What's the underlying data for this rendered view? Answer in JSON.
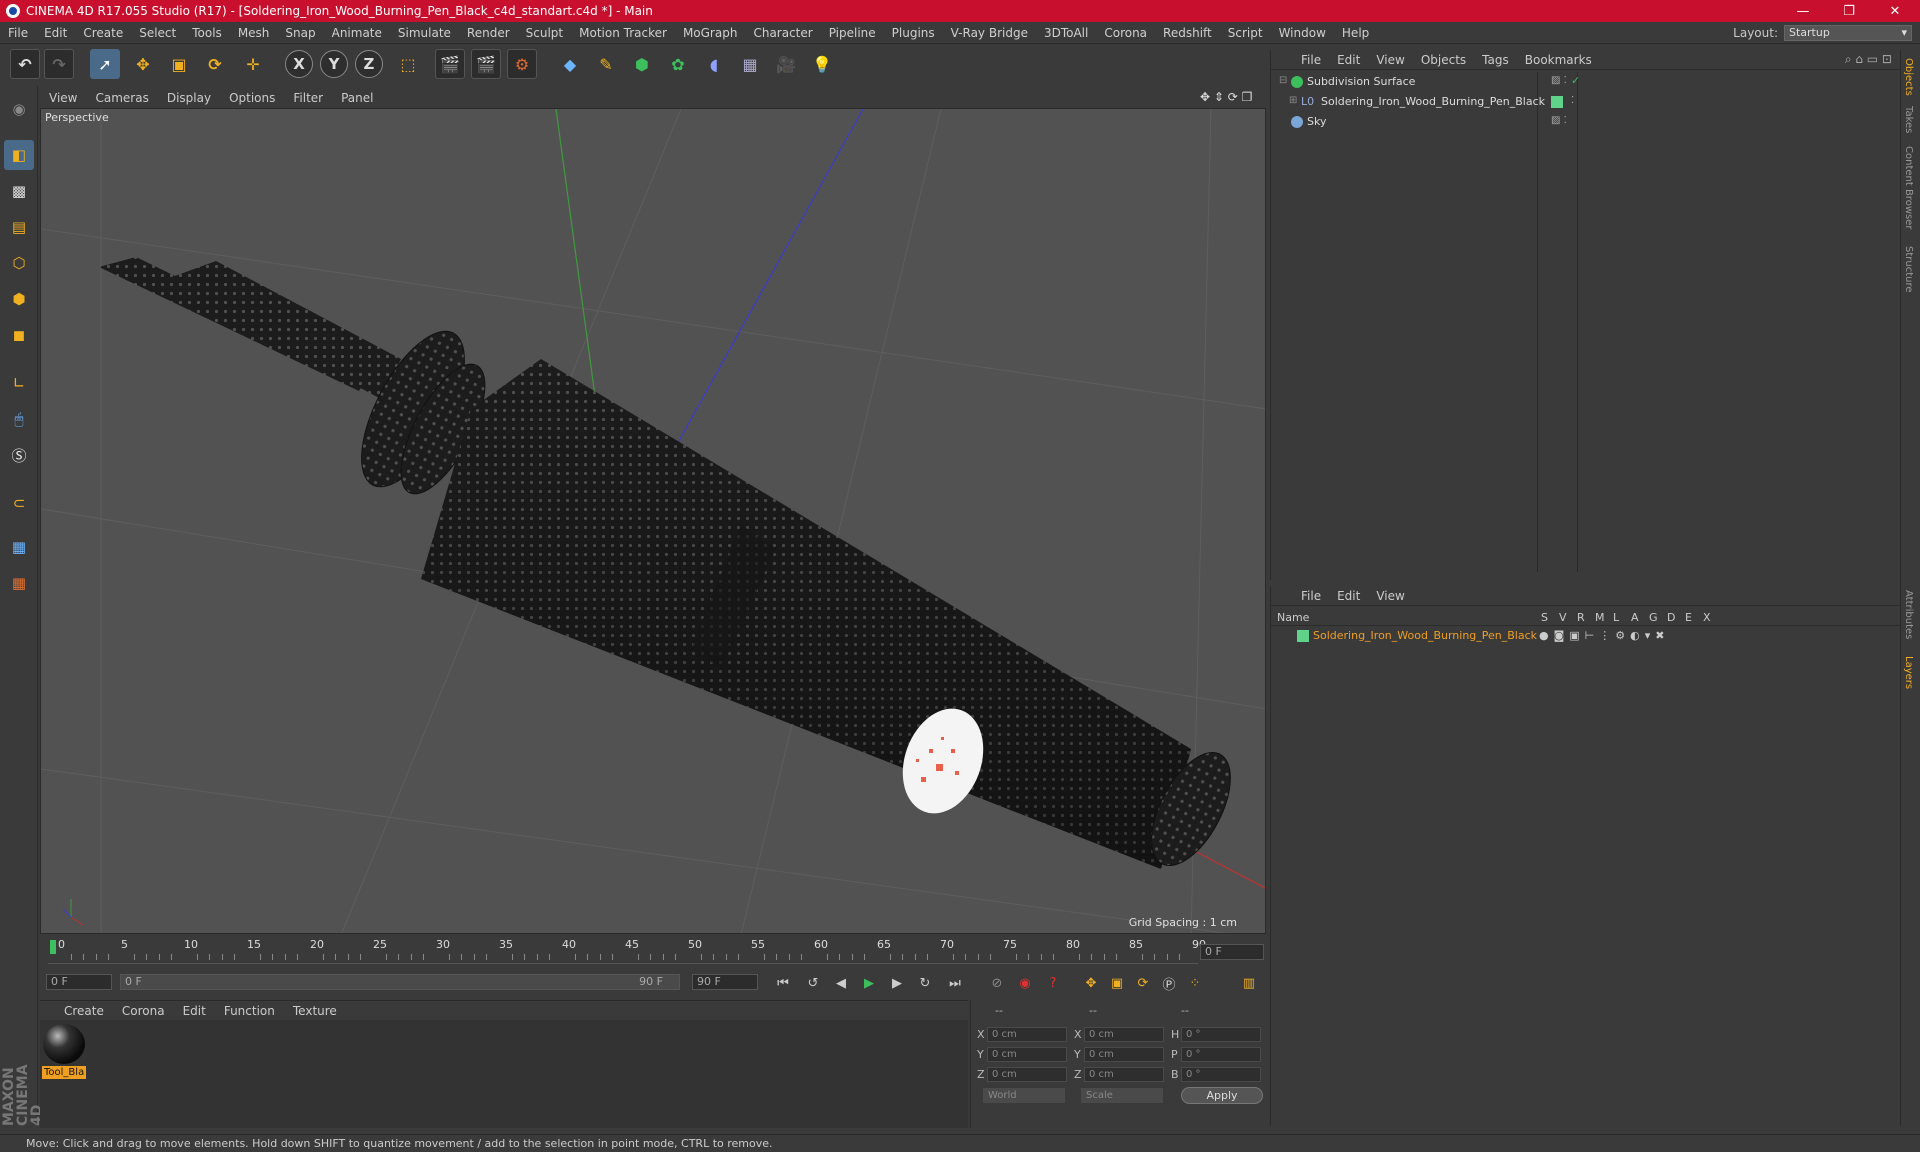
{
  "window": {
    "title": "CINEMA 4D R17.055 Studio (R17) - [Soldering_Iron_Wood_Burning_Pen_Black_c4d_standart.c4d *] - Main",
    "controls": [
      "—",
      "❐",
      "✕"
    ]
  },
  "menu": [
    "File",
    "Edit",
    "Create",
    "Select",
    "Tools",
    "Mesh",
    "Snap",
    "Animate",
    "Simulate",
    "Render",
    "Sculpt",
    "Motion Tracker",
    "MoGraph",
    "Character",
    "Pipeline",
    "Plugins",
    "V-Ray Bridge",
    "3DToAll",
    "Corona",
    "Redshift",
    "Script",
    "Window",
    "Help"
  ],
  "layout": {
    "label": "Layout:",
    "value": "Startup"
  },
  "toolbar": {
    "axis_x": "X",
    "axis_y": "Y",
    "axis_z": "Z"
  },
  "viewport": {
    "menu": [
      "View",
      "Cameras",
      "Display",
      "Options",
      "Filter",
      "Panel"
    ],
    "camera_label": "Perspective",
    "grid_spacing": "Grid Spacing : 1 cm"
  },
  "timeline": {
    "ticks": [
      "0",
      "5",
      "10",
      "15",
      "20",
      "25",
      "30",
      "35",
      "40",
      "45",
      "50",
      "55",
      "60",
      "65",
      "70",
      "75",
      "80",
      "85",
      "90"
    ],
    "current_frame": "0 F",
    "start_field": "0 F",
    "range_start": "0 F",
    "range_end": "90 F",
    "end_field": "90 F"
  },
  "material_manager": {
    "menu": [
      "Create",
      "Corona",
      "Edit",
      "Function",
      "Texture"
    ],
    "materials": [
      {
        "name": "Tool_Bla"
      }
    ]
  },
  "coordinates": {
    "header": [
      "--",
      "--",
      "--"
    ],
    "rows": [
      {
        "axis": "X",
        "pos": "0 cm",
        "axis2": "X",
        "size": "0 cm",
        "rot_label": "H",
        "rot": "0 °"
      },
      {
        "axis": "Y",
        "pos": "0 cm",
        "axis2": "Y",
        "size": "0 cm",
        "rot_label": "P",
        "rot": "0 °"
      },
      {
        "axis": "Z",
        "pos": "0 cm",
        "axis2": "Z",
        "size": "0 cm",
        "rot_label": "B",
        "rot": "0 °"
      }
    ],
    "mode": "World",
    "scale": "Scale",
    "apply": "Apply"
  },
  "object_manager": {
    "menu": [
      "File",
      "Edit",
      "View",
      "Objects",
      "Tags",
      "Bookmarks"
    ],
    "objects": [
      {
        "name": "Subdivision Surface",
        "color": "#3cbf5c"
      },
      {
        "name": "Soldering_Iron_Wood_Burning_Pen_Black",
        "color": "#9ad"
      },
      {
        "name": "Sky",
        "color": "#7aa7d8"
      }
    ]
  },
  "layer_manager": {
    "menu": [
      "File",
      "Edit",
      "View"
    ],
    "columns": [
      "Name",
      "S",
      "V",
      "R",
      "M",
      "L",
      "A",
      "G",
      "D",
      "E",
      "X"
    ],
    "layers": [
      {
        "name": "Soldering_Iron_Wood_Burning_Pen_Black",
        "color": "#5fd38a"
      }
    ]
  },
  "side_tabs": [
    "Objects",
    "Takes",
    "Content Browser",
    "Structure",
    "Attributes",
    "Layers"
  ],
  "brand": "MAXON CINEMA 4D",
  "status": "Move: Click and drag to move elements. Hold down SHIFT to quantize movement / add to the selection in point mode, CTRL to remove."
}
